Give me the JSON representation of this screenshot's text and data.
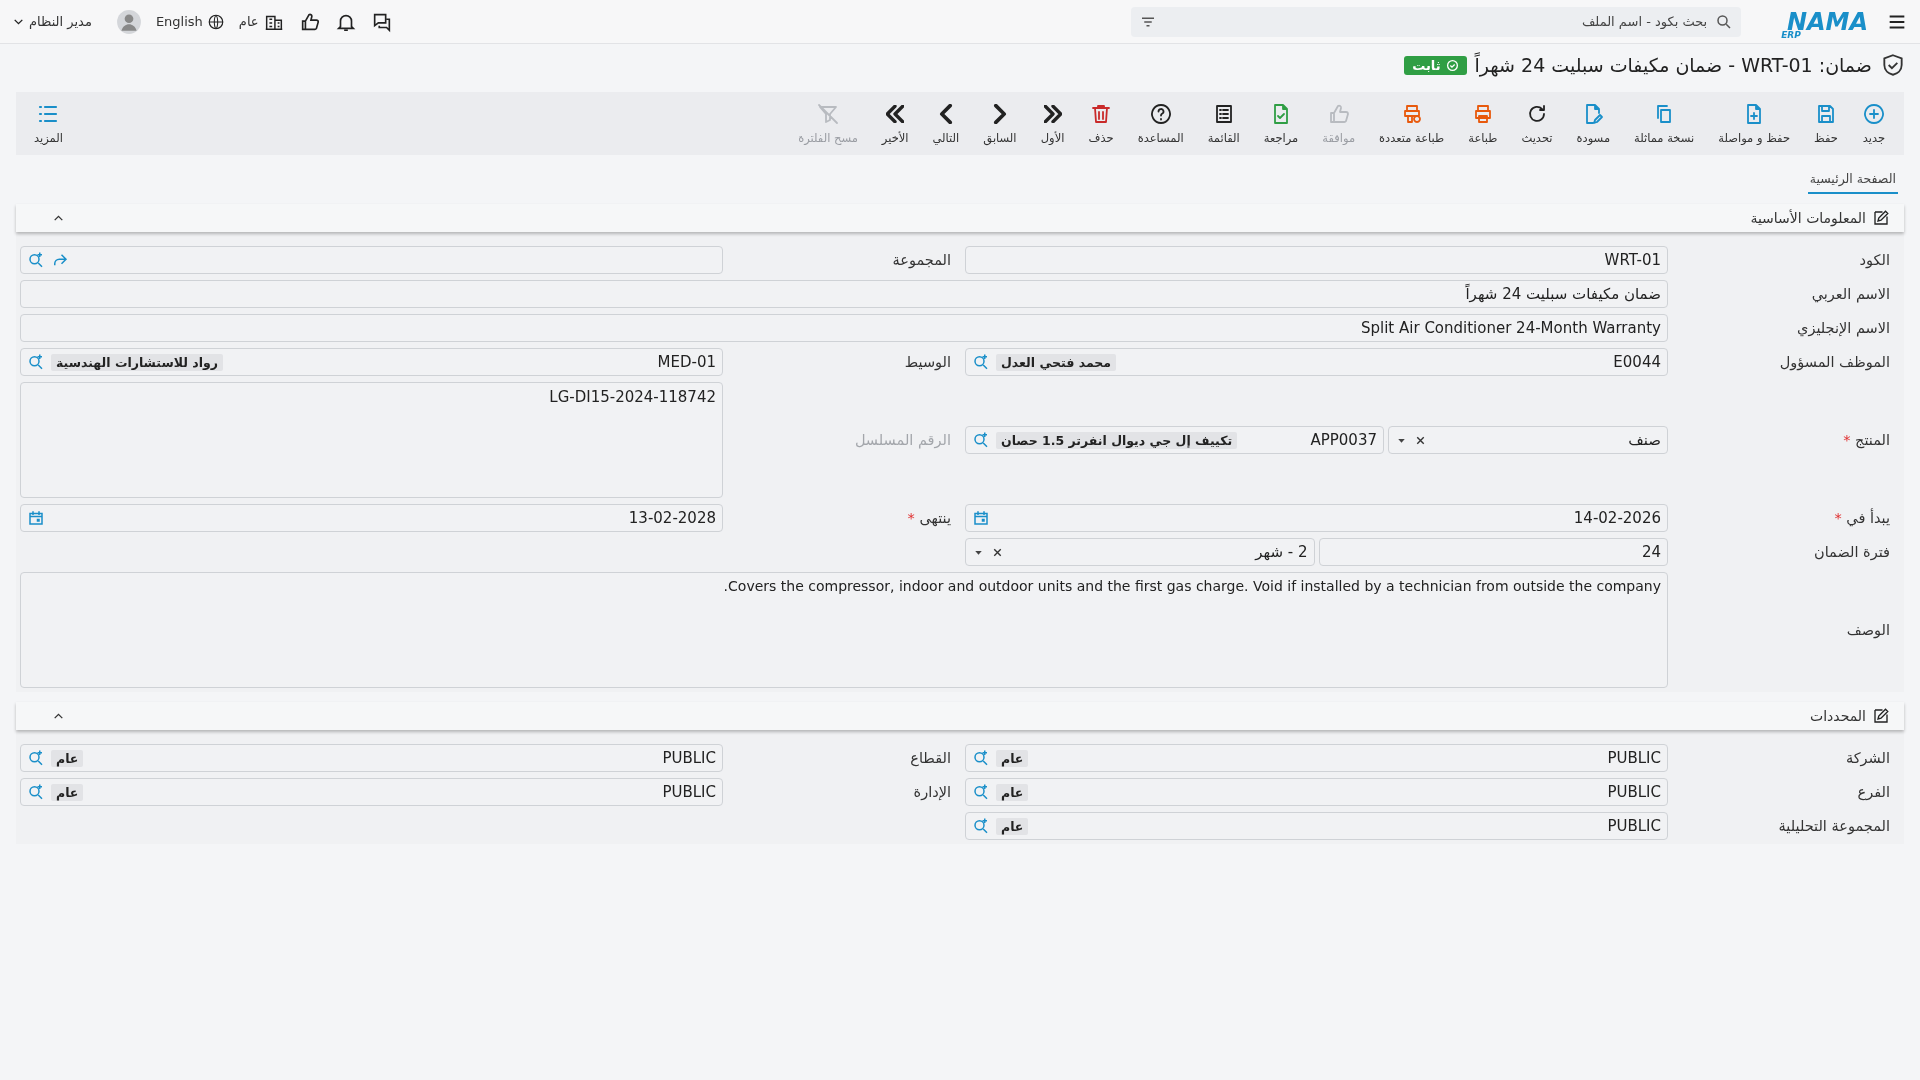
{
  "topbar": {
    "logo": "NAMA",
    "logo_sub": "ERP",
    "search": {
      "placeholder": "بحث بكود - اسم الملف"
    },
    "scope": "عام",
    "language": "English",
    "user": "مدير النظام"
  },
  "title": {
    "text": "ضمان: WRT-01 - ضمان مكيفات سبليت 24 شهراً",
    "status": "ثابت"
  },
  "toolbar": [
    {
      "label": "جديد",
      "color": "#1a8fc9",
      "disabled": false
    },
    {
      "label": "حفظ",
      "color": "#1a8fc9",
      "disabled": false
    },
    {
      "label": "حفظ و مواصلة",
      "color": "#1a8fc9",
      "disabled": false
    },
    {
      "label": "نسخة مماثلة",
      "color": "#1a8fc9",
      "disabled": false
    },
    {
      "label": "مسودة",
      "color": "#1a8fc9",
      "disabled": false
    },
    {
      "label": "تحديث",
      "color": "#222222",
      "disabled": false
    },
    {
      "label": "طباعة",
      "color": "#e8590c",
      "disabled": false
    },
    {
      "label": "طباعة متعددة",
      "color": "#e8590c",
      "disabled": false
    },
    {
      "label": "موافقة",
      "color": "#b8bbc0",
      "disabled": true
    },
    {
      "label": "مراجعة",
      "color": "#2f9e44",
      "disabled": false
    },
    {
      "label": "القائمة",
      "color": "#222222",
      "disabled": false
    },
    {
      "label": "المساعدة",
      "color": "#222222",
      "disabled": false
    },
    {
      "label": "حذف",
      "color": "#c92a2a",
      "disabled": false
    },
    {
      "label": "الأول",
      "color": "#222222",
      "disabled": false
    },
    {
      "label": "السابق",
      "color": "#222222",
      "disabled": false
    },
    {
      "label": "التالي",
      "color": "#222222",
      "disabled": false
    },
    {
      "label": "الأخير",
      "color": "#222222",
      "disabled": false
    },
    {
      "label": "مسح الفلترة",
      "color": "#b8bbc0",
      "disabled": true
    }
  ],
  "more": "المزيد",
  "required_mark": "*",
  "tabs": [
    {
      "label": "الصفحة الرئيسية",
      "selected": true
    }
  ],
  "sections": [
    {
      "title": "المعلومات الأساسية",
      "expanded": true,
      "rows": [
        {
          "fields": [
            {
              "kind": "text",
              "label": "الكود",
              "value": "WRT-01",
              "required": false,
              "disabled": false
            },
            {
              "kind": "link-lookup",
              "label": "المجموعة",
              "required": false,
              "disabled": false
            }
          ]
        },
        {
          "fields": [
            {
              "kind": "wide",
              "label": "الاسم العربي",
              "value": "ضمان مكيفات سبليت 24 شهراً",
              "required": false,
              "disabled": false
            }
          ]
        },
        {
          "fields": [
            {
              "kind": "wide",
              "label": "الاسم الإنجليزي",
              "value": "Split Air Conditioner 24-Month Warranty",
              "required": false,
              "disabled": false
            }
          ]
        },
        {
          "fields": [
            {
              "kind": "lookup",
              "label": "الموظف المسؤول",
              "code": "E0044",
              "name": "محمد فتحي العدل",
              "required": false,
              "disabled": false
            },
            {
              "kind": "lookup",
              "label": "الوسيط",
              "code": "MED-01",
              "name": "رواد للاستشارات الهندسية",
              "required": false,
              "disabled": false
            }
          ]
        },
        {
          "fields": [
            {
              "kind": "product",
              "label": "المنتج",
              "type": "صنف",
              "code": "APP0037",
              "name": "تكييف إل جي ديوال انفرتر 1.5 حصان",
              "required": true,
              "disabled": false
            },
            {
              "kind": "textarea",
              "label": "الرقم المسلسل",
              "value": "LG-DI15-2024-118742",
              "required": false,
              "disabled": true
            }
          ]
        },
        {
          "fields": [
            {
              "kind": "date",
              "label": "يبدأ في",
              "value": "14-02-2026",
              "required": true,
              "disabled": false
            },
            {
              "kind": "date",
              "label": "ينتهى",
              "value": "13-02-2028",
              "required": true,
              "disabled": false
            }
          ]
        },
        {
          "fields": [
            {
              "kind": "period",
              "label": "فترة الضمان",
              "value": "24",
              "unit": "2 - شهر",
              "required": false,
              "disabled": false
            }
          ]
        },
        {
          "fields": [
            {
              "kind": "description",
              "label": "الوصف",
              "value": "Covers the compressor, indoor and outdoor units and the first gas charge. Void if installed by a technician from outside the company.",
              "required": false,
              "disabled": false
            }
          ]
        }
      ]
    },
    {
      "title": "المحددات",
      "expanded": true,
      "rows": [
        {
          "fields": [
            {
              "kind": "lookup",
              "label": "الشركة",
              "code": "PUBLIC",
              "name": "عام",
              "required": false,
              "disabled": false
            },
            {
              "kind": "lookup",
              "label": "القطاع",
              "code": "PUBLIC",
              "name": "عام",
              "required": false,
              "disabled": false
            }
          ]
        },
        {
          "fields": [
            {
              "kind": "lookup",
              "label": "الفرع",
              "code": "PUBLIC",
              "name": "عام",
              "required": false,
              "disabled": false
            },
            {
              "kind": "lookup",
              "label": "الإدارة",
              "code": "PUBLIC",
              "name": "عام",
              "required": false,
              "disabled": false
            }
          ]
        },
        {
          "fields": [
            {
              "kind": "lookup",
              "label": "المجموعة التحليلية",
              "code": "PUBLIC",
              "name": "عام",
              "required": false,
              "disabled": false
            }
          ]
        }
      ]
    }
  ]
}
